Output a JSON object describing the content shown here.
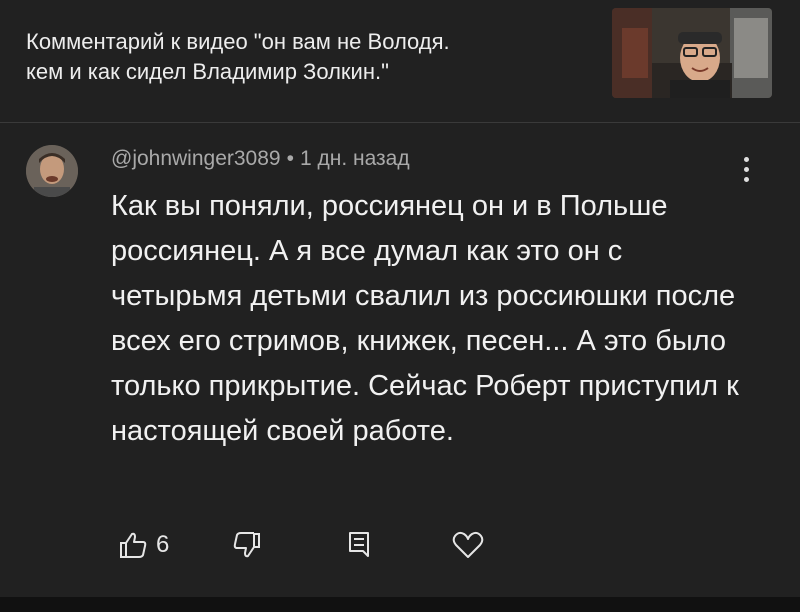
{
  "header": {
    "title_line1": "Комментарий к видео \"он вам не Володя.",
    "title_line2": "кем и как сидел Владимир Золкин.\""
  },
  "thumbnail": {
    "icon": "video-thumbnail"
  },
  "comment": {
    "author": "@johnwinger3089",
    "separator": "•",
    "time": "1 дн. назад",
    "text": "Как вы поняли, россиянец он и в Польше россиянец. А я все думал как это он с четырьмя детьми свалил из россиюшки после всех его стримов, книжек, песен... А это было только прикрытие. Сейчас Роберт приступил к настоящей своей работе."
  },
  "actions": {
    "like_count": "6",
    "like_icon": "thumbs-up-icon",
    "dislike_icon": "thumbs-down-icon",
    "reply_icon": "reply-icon",
    "heart_icon": "heart-icon",
    "more_icon": "more-vertical-icon"
  },
  "colors": {
    "background": "#212121",
    "text": "#f1f1f1",
    "meta_text": "#a9a9a9"
  }
}
